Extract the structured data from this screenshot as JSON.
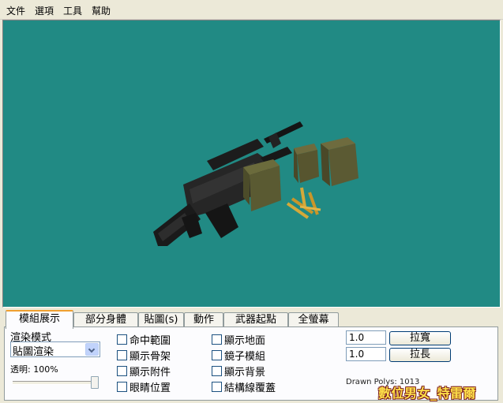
{
  "menu": [
    "文件",
    "選項",
    "工具",
    "幫助"
  ],
  "tabs": [
    "模組展示",
    "部分身體",
    "貼圖(s)",
    "動作",
    "武器起點",
    "全螢幕"
  ],
  "active_tab": 0,
  "render_mode": {
    "label": "渲染模式",
    "selected": "貼圖渲染"
  },
  "transparency": {
    "label": "透明: 100%",
    "value": 1.0
  },
  "checkboxes_col1": [
    "命中範圍",
    "顯示骨架",
    "顯示附件",
    "眼睛位置"
  ],
  "checkboxes_col2": [
    "顯示地面",
    "鏡子模組",
    "顯示背景",
    "結構線覆蓋"
  ],
  "scale": {
    "width_value": "1.0",
    "width_button": "拉寬",
    "length_value": "1.0",
    "length_button": "拉長"
  },
  "stats": {
    "drawn_polys": "Drawn Polys: 1013"
  },
  "watermark": "數位男女_特雷爾",
  "colors": {
    "viewport_bg": "#218a84",
    "tab_highlight": "#f0a030"
  }
}
